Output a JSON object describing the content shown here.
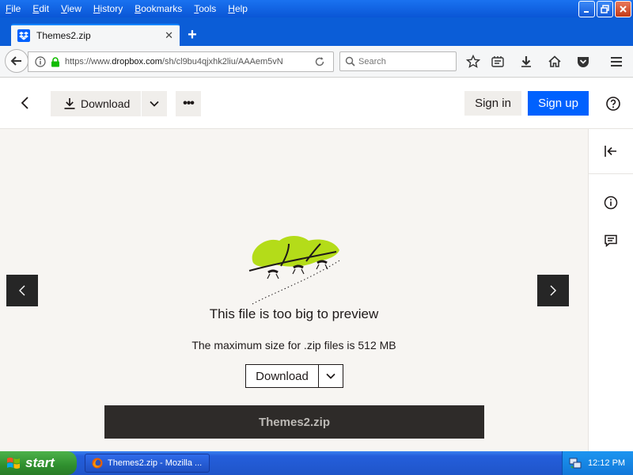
{
  "browser": {
    "menu": [
      "File",
      "Edit",
      "View",
      "History",
      "Bookmarks",
      "Tools",
      "Help"
    ],
    "menu_underline": [
      "F",
      "E",
      "V",
      "H",
      "B",
      "T",
      "H"
    ],
    "menu_rest": [
      "ile",
      "dit",
      "iew",
      "istory",
      "ookmarks",
      "ools",
      "elp"
    ],
    "tab_title": "Themes2.zip",
    "new_tab": "+",
    "url_prefix": "https://www.",
    "url_domain": "dropbox.com",
    "url_rest": "/sh/cl9bu4qjxhk2liu/AAAem5vN",
    "search_placeholder": "Search"
  },
  "page": {
    "download_label": "Download",
    "more_label": "•••",
    "sign_in_label": "Sign in",
    "sign_up_label": "Sign up",
    "preview_title": "This file is too big to preview",
    "preview_subtitle": "The maximum size for .zip files is 512 MB",
    "download_button_label": "Download",
    "file_name": "Themes2.zip"
  },
  "taskbar": {
    "start_label": "start",
    "task_label": "Themes2.zip - Mozilla ...",
    "clock": "12:12 PM"
  },
  "colors": {
    "accent": "#0061fe",
    "leaf": "#b4dc19",
    "xp_blue": "#245edb",
    "xp_green": "#2f8f2e"
  }
}
